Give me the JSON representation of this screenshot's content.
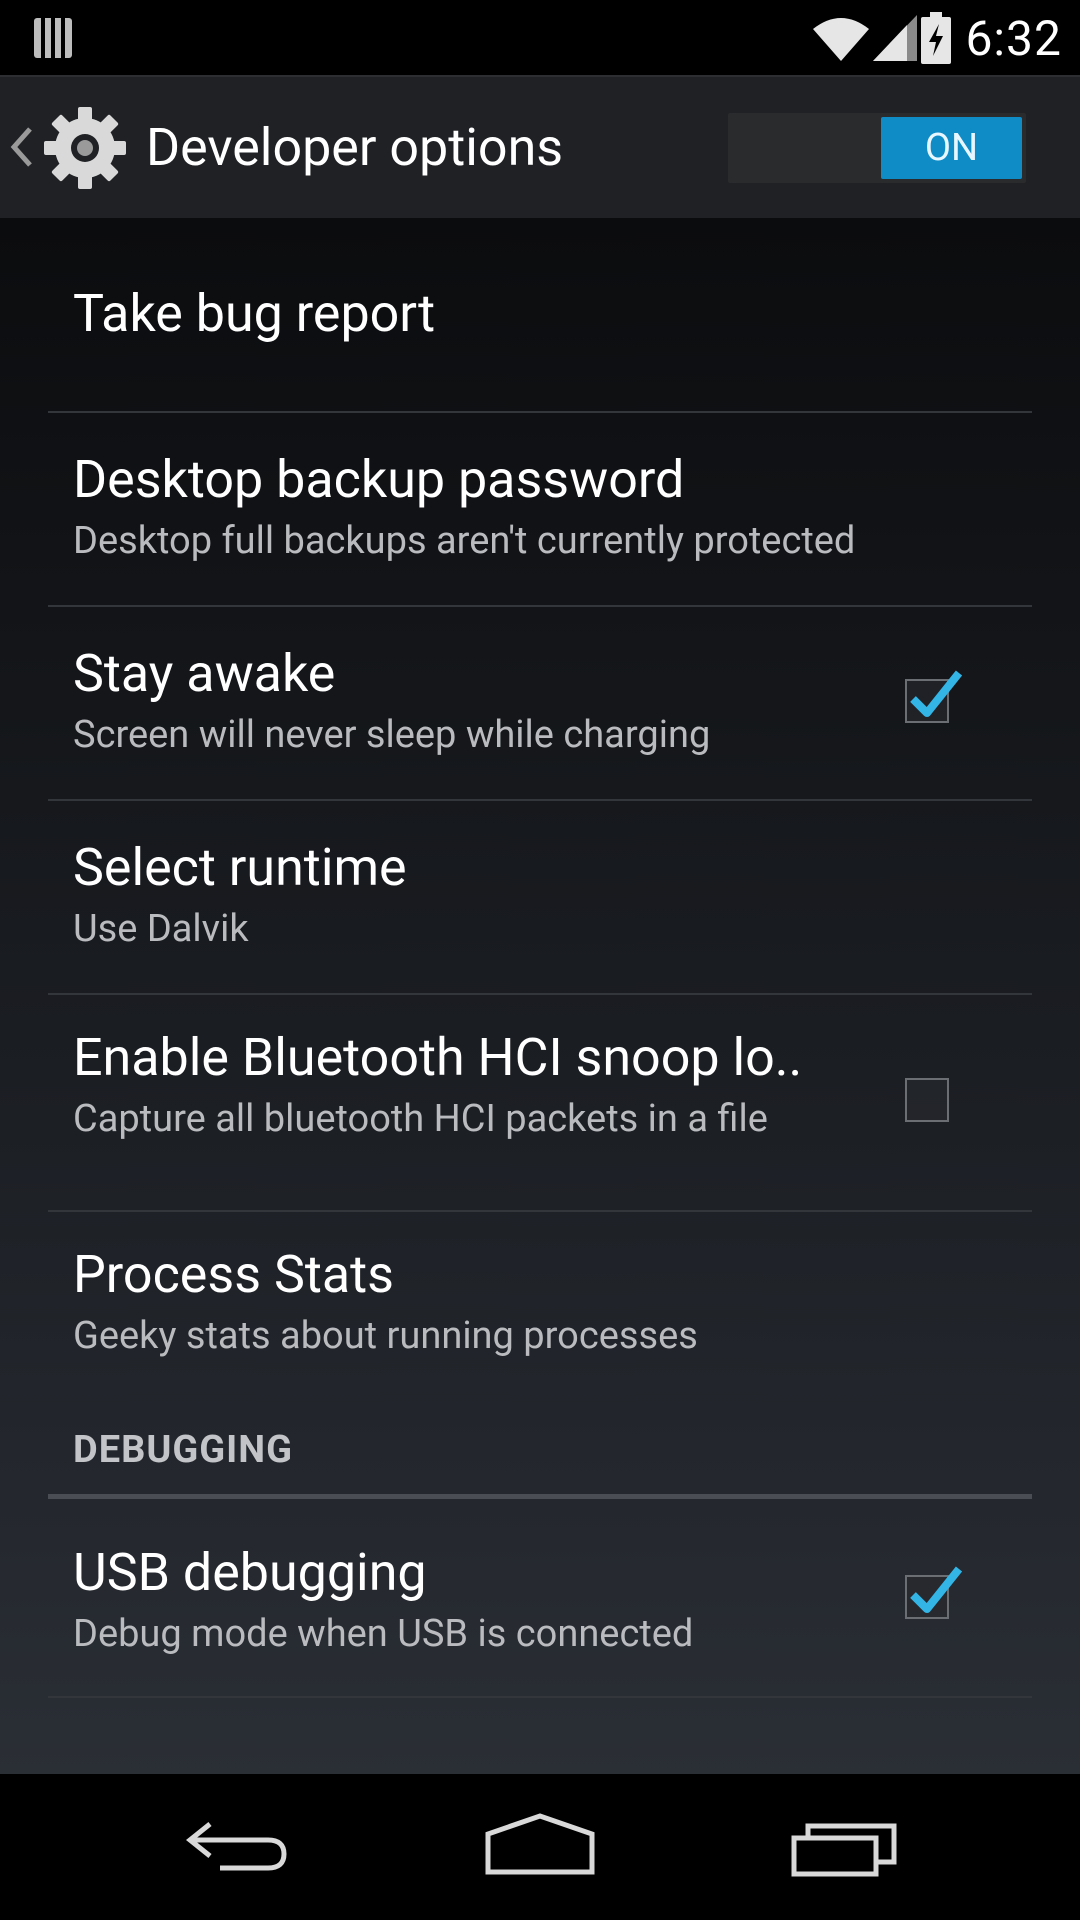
{
  "status_bar": {
    "time": "6:32",
    "icons": [
      "notification-icon",
      "wifi-icon",
      "signal-icon",
      "battery-charging-icon"
    ]
  },
  "action_bar": {
    "title": "Developer options",
    "switch_label": "ON",
    "switch_state": "on"
  },
  "items": [
    {
      "title": "Take bug report",
      "subtitle": ""
    },
    {
      "title": "Desktop backup password",
      "subtitle": "Desktop full backups aren't currently protected"
    },
    {
      "title": "Stay awake",
      "subtitle": "Screen will never sleep while charging",
      "checked": true
    },
    {
      "title": "Select runtime",
      "subtitle": "Use Dalvik"
    },
    {
      "title": "Enable Bluetooth HCI snoop lo..",
      "subtitle": "Capture all bluetooth HCI packets in a file",
      "checked": false
    },
    {
      "title": "Process Stats",
      "subtitle": "Geeky stats about running processes"
    },
    {
      "title": "USB debugging",
      "subtitle": "Debug mode when USB is connected",
      "checked": true
    }
  ],
  "category": {
    "label": "DEBUGGING"
  },
  "nav": [
    "back-icon",
    "home-icon",
    "recents-icon"
  ],
  "colors": {
    "accent": "#0f8cc6",
    "check": "#33b5e5",
    "background": "#000000"
  }
}
